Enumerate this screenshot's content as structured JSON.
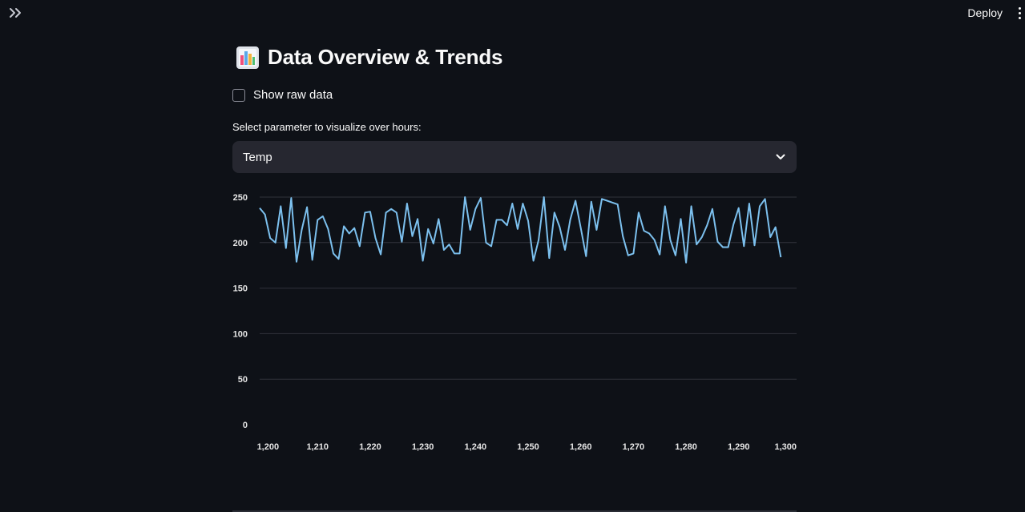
{
  "header": {
    "deploy_label": "Deploy",
    "sidebar_toggle_icon": "double-chevron-right-icon",
    "menu_icon": "vertical-ellipsis-icon"
  },
  "main": {
    "title": "Data Overview & Trends",
    "title_icon": "bar-chart-emoji-icon",
    "show_raw_checkbox": {
      "label": "Show raw data",
      "checked": false
    },
    "select": {
      "label": "Select parameter to visualize over hours:",
      "value": "Temp"
    }
  },
  "colors": {
    "background": "#0e1117",
    "select_background": "#262730",
    "line": "#7cc0ee",
    "grid": "#30333b"
  },
  "chart_data": {
    "type": "line",
    "xlabel": "",
    "ylabel": "",
    "xlim": [
      1199,
      1301
    ],
    "ylim": [
      0,
      250
    ],
    "grid": "horizontal",
    "x_ticks": [
      "1,200",
      "1,210",
      "1,220",
      "1,230",
      "1,240",
      "1,250",
      "1,260",
      "1,270",
      "1,280",
      "1,290",
      "1,300"
    ],
    "y_ticks": [
      "0",
      "50",
      "100",
      "150",
      "200",
      "250"
    ],
    "x": [
      1199,
      1200,
      1201,
      1202,
      1203,
      1204,
      1205,
      1206,
      1207,
      1208,
      1209,
      1210,
      1211,
      1212,
      1213,
      1214,
      1215,
      1216,
      1217,
      1218,
      1219,
      1220,
      1221,
      1222,
      1223,
      1224,
      1225,
      1226,
      1227,
      1228,
      1229,
      1230,
      1231,
      1232,
      1233,
      1234,
      1235,
      1236,
      1237,
      1238,
      1239,
      1240,
      1241,
      1242,
      1243,
      1244,
      1245,
      1246,
      1247,
      1248,
      1249,
      1250,
      1251,
      1252,
      1253,
      1254,
      1255,
      1256,
      1257,
      1258,
      1259,
      1260,
      1261,
      1262,
      1263,
      1264,
      1265,
      1266,
      1267,
      1268,
      1269,
      1270,
      1271,
      1272,
      1273,
      1274,
      1275,
      1276,
      1277,
      1278,
      1279,
      1280,
      1281,
      1282,
      1283,
      1284,
      1285,
      1286,
      1287,
      1288,
      1289,
      1290,
      1291,
      1292,
      1293,
      1294,
      1295,
      1296,
      1297,
      1298,
      1299,
      1300,
      1301
    ],
    "values": [
      238,
      231,
      205,
      200,
      240,
      194,
      249,
      179,
      214,
      239,
      181,
      225,
      229,
      215,
      188,
      182,
      218,
      210,
      216,
      196,
      233,
      234,
      205,
      187,
      233,
      237,
      233,
      201,
      243,
      207,
      226,
      180,
      215,
      199,
      226,
      192,
      198,
      188,
      188,
      250,
      214,
      237,
      249,
      200,
      196,
      225,
      225,
      219,
      243,
      215,
      243,
      224,
      180,
      203,
      250,
      183,
      233,
      217,
      192,
      225,
      246,
      216,
      185,
      245,
      214,
      248,
      246,
      244,
      242,
      207,
      186,
      188,
      233,
      213,
      210,
      203,
      187,
      240,
      203,
      186,
      226,
      178,
      240,
      198,
      206,
      219,
      237,
      201,
      195,
      195,
      220,
      238,
      196,
      243,
      197,
      240,
      248,
      206,
      217,
      184
    ]
  }
}
